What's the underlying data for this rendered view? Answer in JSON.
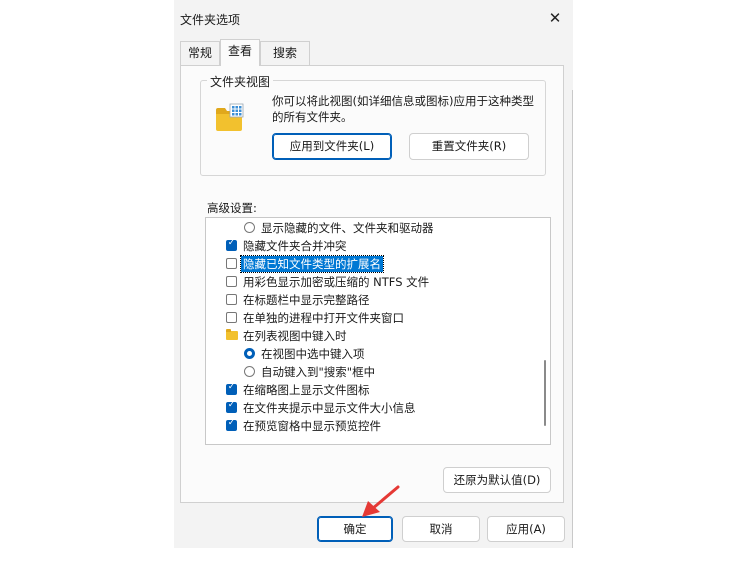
{
  "dialog": {
    "title": "文件夹选项",
    "close_glyph": "✕"
  },
  "tabs": [
    "常规",
    "查看",
    "搜索"
  ],
  "folder_views": {
    "legend": "文件夹视图",
    "description": "你可以将此视图(如详细信息或图标)应用于这种类型的所有文件夹。",
    "apply_button": "应用到文件夹(L)",
    "reset_button": "重置文件夹(R)"
  },
  "advanced": {
    "label": "高级设置:",
    "items": [
      {
        "kind": "radio",
        "checked": false,
        "indent": 1,
        "label": "显示隐藏的文件、文件夹和驱动器"
      },
      {
        "kind": "checkbox",
        "checked": true,
        "indent": 0,
        "label": "隐藏文件夹合并冲突"
      },
      {
        "kind": "checkbox",
        "checked": false,
        "indent": 0,
        "label": "隐藏已知文件类型的扩展名",
        "selected": true
      },
      {
        "kind": "checkbox",
        "checked": false,
        "indent": 0,
        "label": "用彩色显示加密或压缩的 NTFS 文件"
      },
      {
        "kind": "checkbox",
        "checked": false,
        "indent": 0,
        "label": "在标题栏中显示完整路径"
      },
      {
        "kind": "checkbox",
        "checked": false,
        "indent": 0,
        "label": "在单独的进程中打开文件夹窗口"
      },
      {
        "kind": "folder",
        "checked": false,
        "indent": 0,
        "label": "在列表视图中键入时"
      },
      {
        "kind": "radio",
        "checked": true,
        "indent": 1,
        "label": "在视图中选中键入项"
      },
      {
        "kind": "radio",
        "checked": false,
        "indent": 1,
        "label": "自动键入到\"搜索\"框中"
      },
      {
        "kind": "checkbox",
        "checked": true,
        "indent": 0,
        "label": "在缩略图上显示文件图标"
      },
      {
        "kind": "checkbox",
        "checked": true,
        "indent": 0,
        "label": "在文件夹提示中显示文件大小信息"
      },
      {
        "kind": "checkbox",
        "checked": true,
        "indent": 0,
        "label": "在预览窗格中显示预览控件"
      }
    ],
    "restore_button": "还原为默认值(D)"
  },
  "footer": {
    "ok": "确定",
    "cancel": "取消",
    "apply": "应用(A)"
  },
  "colors": {
    "accent": "#005fb8",
    "arrow": "#e53935",
    "folder": "#f2c12e"
  }
}
